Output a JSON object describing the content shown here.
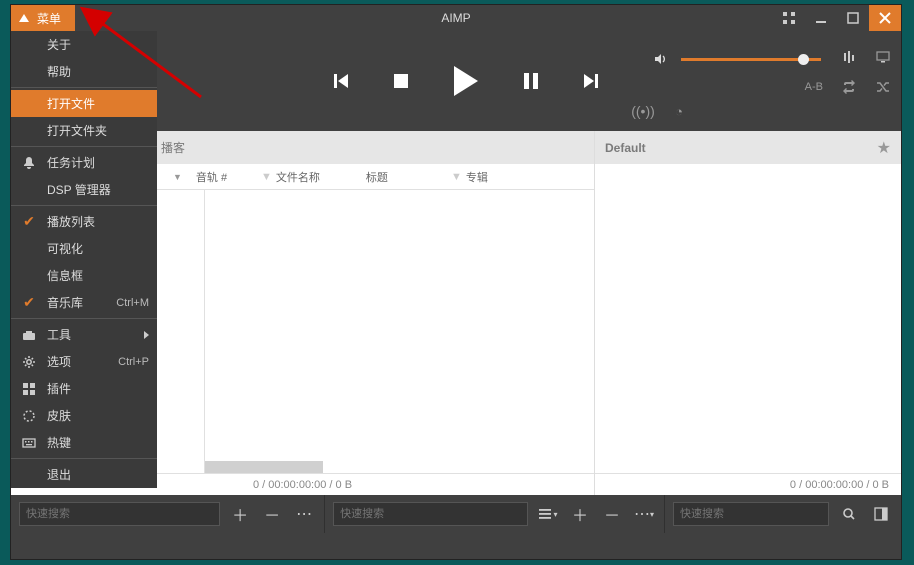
{
  "title": "AIMP",
  "menu_button": "菜单",
  "menu": {
    "about": "关于",
    "help": "帮助",
    "open_file": "打开文件",
    "open_folder": "打开文件夹",
    "scheduler": "任务计划",
    "dsp": "DSP 管理器",
    "playlist": "播放列表",
    "visual": "可视化",
    "infobox": "信息框",
    "music_lib": "音乐库",
    "sc_music_lib": "Ctrl+M",
    "tools": "工具",
    "options": "选项",
    "sc_options": "Ctrl+P",
    "plugins": "插件",
    "skins": "皮肤",
    "hotkeys": "热键",
    "exit": "退出"
  },
  "player": {
    "ab_label": "A-B"
  },
  "left": {
    "tab_label": "播客",
    "cols": {
      "track": "音轨 #",
      "filename": "文件名称",
      "title": "标题",
      "album": "专辑"
    },
    "status": "0 / 00:00:00:00 / 0 B"
  },
  "right": {
    "tab_label": "Default",
    "status": "0 / 00:00:00:00 / 0 B"
  },
  "search_placeholder": "快速搜索"
}
